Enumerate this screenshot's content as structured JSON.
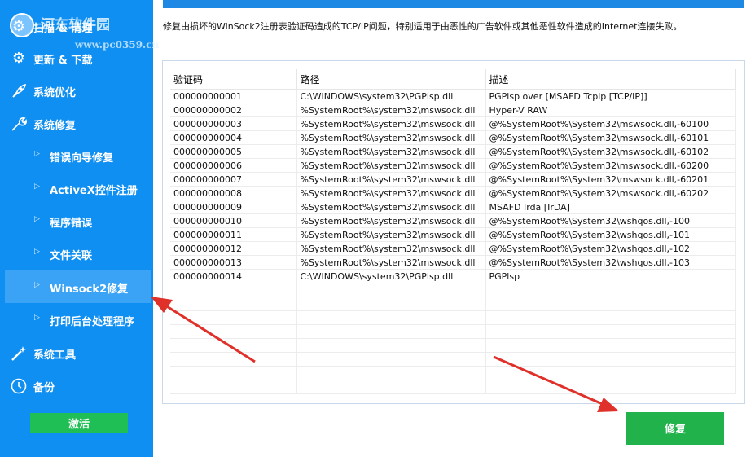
{
  "watermark": {
    "site": "河东软件园",
    "url": "www.pc0359.cn"
  },
  "sidebar": {
    "items": [
      {
        "label": "扫描 & 清理",
        "icon": "scan-icon"
      },
      {
        "label": "更新 & 下载",
        "icon": "gears-icon"
      },
      {
        "label": "系统优化",
        "icon": "rocket-icon"
      },
      {
        "label": "系统修复",
        "icon": "wrench-icon"
      }
    ],
    "sub_items": [
      {
        "label": "错误向导修复"
      },
      {
        "label": "ActiveX控件注册"
      },
      {
        "label": "程序错误"
      },
      {
        "label": "文件关联"
      },
      {
        "label": "Winsock2修复",
        "active": true
      },
      {
        "label": "打印后台处理程序"
      }
    ],
    "bottom_items": [
      {
        "label": "系统工具",
        "icon": "wand-icon"
      },
      {
        "label": "备份",
        "icon": "clock-icon"
      }
    ],
    "activate_label": "激活"
  },
  "description": "修复由损坏的WinSock2注册表验证码造成的TCP/IP问题，特别适用于由恶性的广告软件或其他恶性软件造成的Internet连接失败。",
  "table": {
    "columns": [
      "验证码",
      "路径",
      "描述"
    ],
    "rows": [
      [
        "000000000001",
        "C:\\WINDOWS\\system32\\PGPlsp.dll",
        "PGPlsp over [MSAFD Tcpip [TCP/IP]]"
      ],
      [
        "000000000002",
        "%SystemRoot%\\system32\\mswsock.dll",
        "Hyper-V RAW"
      ],
      [
        "000000000003",
        "%SystemRoot%\\system32\\mswsock.dll",
        "@%SystemRoot%\\System32\\mswsock.dll,-60100"
      ],
      [
        "000000000004",
        "%SystemRoot%\\system32\\mswsock.dll",
        "@%SystemRoot%\\System32\\mswsock.dll,-60101"
      ],
      [
        "000000000005",
        "%SystemRoot%\\system32\\mswsock.dll",
        "@%SystemRoot%\\System32\\mswsock.dll,-60102"
      ],
      [
        "000000000006",
        "%SystemRoot%\\system32\\mswsock.dll",
        "@%SystemRoot%\\System32\\mswsock.dll,-60200"
      ],
      [
        "000000000007",
        "%SystemRoot%\\system32\\mswsock.dll",
        "@%SystemRoot%\\System32\\mswsock.dll,-60201"
      ],
      [
        "000000000008",
        "%SystemRoot%\\system32\\mswsock.dll",
        "@%SystemRoot%\\System32\\mswsock.dll,-60202"
      ],
      [
        "000000000009",
        "%SystemRoot%\\system32\\mswsock.dll",
        "MSAFD Irda [IrDA]"
      ],
      [
        "000000000010",
        "%SystemRoot%\\system32\\mswsock.dll",
        "@%SystemRoot%\\System32\\wshqos.dll,-100"
      ],
      [
        "000000000011",
        "%SystemRoot%\\system32\\mswsock.dll",
        "@%SystemRoot%\\System32\\wshqos.dll,-101"
      ],
      [
        "000000000012",
        "%SystemRoot%\\system32\\mswsock.dll",
        "@%SystemRoot%\\System32\\wshqos.dll,-102"
      ],
      [
        "000000000013",
        "%SystemRoot%\\system32\\mswsock.dll",
        "@%SystemRoot%\\System32\\wshqos.dll,-103"
      ],
      [
        "000000000014",
        "C:\\WINDOWS\\system32\\PGPlsp.dll",
        "PGPlsp"
      ]
    ],
    "empty_rows": 8
  },
  "fix_button_label": "修复",
  "colors": {
    "sidebar": "#0f8ff2",
    "active_item": "#3aa3f5",
    "button_green": "#21b24b",
    "arrow_red": "#e0302a"
  }
}
